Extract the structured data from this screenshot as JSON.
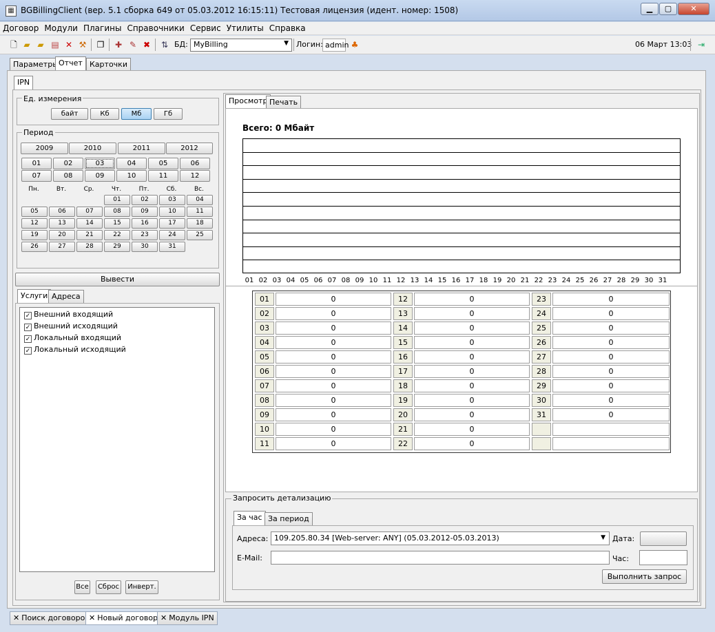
{
  "window": {
    "title": "BGBillingClient (вер. 5.1 сборка 649 от 05.03.2012 16:15:11) Тестовая лицензия (идент. номер: 1508)",
    "minimize": "▁",
    "maximize": "▢",
    "close": "✕"
  },
  "menu": [
    "Договор",
    "Модули",
    "Плагины",
    "Справочники",
    "Сервис",
    "Утилиты",
    "Справка"
  ],
  "toolbar": {
    "db_label": "БД:",
    "db_value": "MyBilling",
    "login_label": "Логин:",
    "login_value": "admin",
    "datetime": "06 Март 13:03"
  },
  "top_tabs": [
    "Параметры",
    "Отчет",
    "Карточки"
  ],
  "module_tab": "IPN",
  "units": {
    "title": "Ед. измерения",
    "options": [
      "байт",
      "Кб",
      "Мб",
      "Гб"
    ],
    "selected": "Мб"
  },
  "period": {
    "title": "Период",
    "years": [
      "2009",
      "2010",
      "2011",
      "2012"
    ],
    "months_row1": [
      "01",
      "02",
      "03",
      "04",
      "05",
      "06"
    ],
    "months_row2": [
      "07",
      "08",
      "09",
      "10",
      "11",
      "12"
    ],
    "selected_month": "03",
    "weekdays": [
      "Пн.",
      "Вт.",
      "Ср.",
      "Чт.",
      "Пт.",
      "Сб.",
      "Вс."
    ],
    "weeks": [
      [
        "",
        "",
        "",
        "01",
        "02",
        "03",
        "04"
      ],
      [
        "05",
        "06",
        "07",
        "08",
        "09",
        "10",
        "11"
      ],
      [
        "12",
        "13",
        "14",
        "15",
        "16",
        "17",
        "18"
      ],
      [
        "19",
        "20",
        "21",
        "22",
        "23",
        "24",
        "25"
      ],
      [
        "26",
        "27",
        "28",
        "29",
        "30",
        "31",
        ""
      ]
    ]
  },
  "output_button": "Вывести",
  "services_tabs": [
    "Услуги",
    "Адреса"
  ],
  "services": [
    {
      "label": "Внешний входящий",
      "checked": true
    },
    {
      "label": "Внешний исходящий",
      "checked": true
    },
    {
      "label": "Локальный входящий",
      "checked": true
    },
    {
      "label": "Локальный исходящий",
      "checked": true
    }
  ],
  "service_buttons": [
    "Все",
    "Сброс",
    "Инверт."
  ],
  "view_tabs": [
    "Просмотр",
    "Печать"
  ],
  "total_label": "Всего: 0 Мбайт",
  "chart_data": {
    "type": "bar",
    "title": "Всего: 0 Мбайт",
    "categories": [
      "01",
      "02",
      "03",
      "04",
      "05",
      "06",
      "07",
      "08",
      "09",
      "10",
      "11",
      "12",
      "13",
      "14",
      "15",
      "16",
      "17",
      "18",
      "19",
      "20",
      "21",
      "22",
      "23",
      "24",
      "25",
      "26",
      "27",
      "28",
      "29",
      "30",
      "31"
    ],
    "values": [
      0,
      0,
      0,
      0,
      0,
      0,
      0,
      0,
      0,
      0,
      0,
      0,
      0,
      0,
      0,
      0,
      0,
      0,
      0,
      0,
      0,
      0,
      0,
      0,
      0,
      0,
      0,
      0,
      0,
      0,
      0
    ],
    "grid": true,
    "gridlines": 10
  },
  "day_table": [
    {
      "day": "01",
      "value": "0"
    },
    {
      "day": "02",
      "value": "0"
    },
    {
      "day": "03",
      "value": "0"
    },
    {
      "day": "04",
      "value": "0"
    },
    {
      "day": "05",
      "value": "0"
    },
    {
      "day": "06",
      "value": "0"
    },
    {
      "day": "07",
      "value": "0"
    },
    {
      "day": "08",
      "value": "0"
    },
    {
      "day": "09",
      "value": "0"
    },
    {
      "day": "10",
      "value": "0"
    },
    {
      "day": "11",
      "value": "0"
    },
    {
      "day": "12",
      "value": "0"
    },
    {
      "day": "13",
      "value": "0"
    },
    {
      "day": "14",
      "value": "0"
    },
    {
      "day": "15",
      "value": "0"
    },
    {
      "day": "16",
      "value": "0"
    },
    {
      "day": "17",
      "value": "0"
    },
    {
      "day": "18",
      "value": "0"
    },
    {
      "day": "19",
      "value": "0"
    },
    {
      "day": "20",
      "value": "0"
    },
    {
      "day": "21",
      "value": "0"
    },
    {
      "day": "22",
      "value": "0"
    },
    {
      "day": "23",
      "value": "0"
    },
    {
      "day": "24",
      "value": "0"
    },
    {
      "day": "25",
      "value": "0"
    },
    {
      "day": "26",
      "value": "0"
    },
    {
      "day": "27",
      "value": "0"
    },
    {
      "day": "28",
      "value": "0"
    },
    {
      "day": "29",
      "value": "0"
    },
    {
      "day": "30",
      "value": "0"
    },
    {
      "day": "31",
      "value": "0"
    }
  ],
  "detail": {
    "title": "Запросить детализацию",
    "tabs": [
      "За час",
      "За период"
    ],
    "address_label": "Адреса:",
    "address_value": "109.205.80.34 [Web-server: ANY] (05.03.2012-05.03.2013)",
    "date_label": "Дата:",
    "email_label": "E-Mail:",
    "hour_label": "Час:",
    "execute_button": "Выполнить запрос"
  },
  "bottom_tabs": [
    "Поиск договоров",
    "Новый договор",
    "Модуль IPN"
  ],
  "icons": {
    "new": "new-document-icon",
    "open": "open-folder-icon",
    "refresh": "refresh-icon",
    "exit": "exit-icon"
  }
}
